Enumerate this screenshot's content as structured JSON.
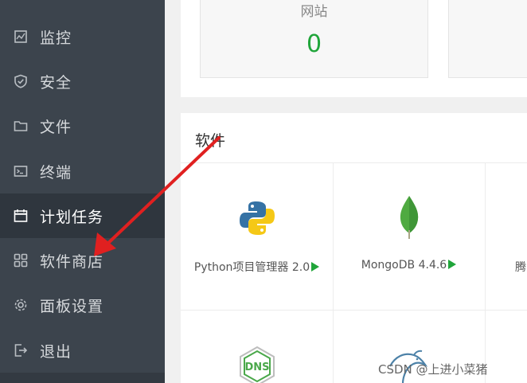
{
  "sidebar": {
    "items": [
      {
        "label": "监控",
        "icon": "monitor-icon"
      },
      {
        "label": "安全",
        "icon": "shield-icon"
      },
      {
        "label": "文件",
        "icon": "folder-icon"
      },
      {
        "label": "终端",
        "icon": "terminal-icon"
      },
      {
        "label": "计划任务",
        "icon": "calendar-icon",
        "active": true
      },
      {
        "label": "软件商店",
        "icon": "grid-icon"
      },
      {
        "label": "面板设置",
        "icon": "gear-icon"
      },
      {
        "label": "退出",
        "icon": "logout-icon"
      }
    ]
  },
  "stats": {
    "site_label": "网站",
    "site_count": "0"
  },
  "software": {
    "title": "软件",
    "items": [
      {
        "name": "Python项目管理器 2.0",
        "icon": "python-logo-icon"
      },
      {
        "name": "MongoDB 4.4.6",
        "icon": "mongodb-leaf-icon"
      },
      {
        "name": "腾",
        "icon": "none"
      },
      {
        "name": "",
        "icon": "dns-icon"
      },
      {
        "name": "",
        "icon": "mysql-dolphin-icon"
      }
    ]
  },
  "watermark": "CSDN @上进小菜猪",
  "colors": {
    "sidebar_bg": "#3c444d",
    "sidebar_active_bg": "#2f363e",
    "accent_green": "#20a53a",
    "annotation_red": "#e02020"
  }
}
